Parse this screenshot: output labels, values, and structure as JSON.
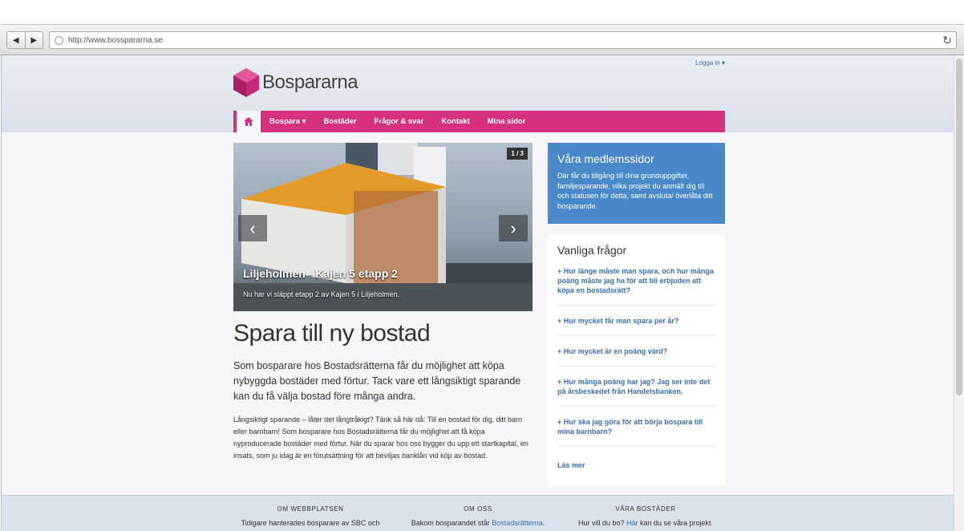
{
  "browser": {
    "url": "http://www.bosspararna.se",
    "back_icon": "back-icon",
    "forward_icon": "forward-icon",
    "reload_icon": "reload-icon"
  },
  "header": {
    "login_label": "Logga in ▾",
    "logo_text": "Bospararna"
  },
  "nav": {
    "home_icon": "home-icon",
    "items": [
      "Bospara ▾",
      "Bostäder",
      "Frågor & svar",
      "Kontakt",
      "Mina sidor"
    ]
  },
  "slider": {
    "counter": "1 / 3",
    "title": "Liljeholmen - Kajen 5 etapp 2",
    "text": "Nu har vi släppt etapp 2 av Kajen 5 i Liljeholmen."
  },
  "main": {
    "heading": "Spara till ny bostad",
    "lead": "Som bosparare hos Bostadsrätterna får du möjlighet att köpa nybyggda bostäder med förtur. Tack vare ett långsiktigt sparande kan du få välja bostad före många andra.",
    "body": "Långsiktigt sparande – låter det långtråkigt? Tänk så här då: Till en bostad för dig, ditt barn eller barnbarn! Som bosparare hos Bostadsrätterna får du möjlighet att få köpa nyproducerade bostäder med förtur. När du sparar hos oss bygger du upp ett startkapital, en insats, som ju idag är en förutsättning för att beviljas banklån vid köp av bostad."
  },
  "members_box": {
    "title": "Våra medlemssidor",
    "text": "Där får du tillgång till dina grunduppgifter, familjesparande, vilka projekt du anmält dig till och statusen för detta, samt avsluta/ överlåta ditt bosparande."
  },
  "faq": {
    "title": "Vanliga frågor",
    "items": [
      "Hur länge måste man spara, och hur många poäng måste jag ha för att bli erbjuden att köpa en bostadsrätt?",
      "Hur mycket får man spara per år?",
      "Hur mycket är en poäng värd?",
      "Hur många poäng har jag? Jag ser inte det på årsbeskedet från Handelsbanken.",
      "Hur ska jag göra för att börja bospara till mina barnbarn?"
    ],
    "more_label": "Läs mer"
  },
  "footer": {
    "col1_title": "OM WEBBPLATSEN",
    "col1_text": "Tidigare hanterades bosparare av SBC och",
    "col2_title": "OM OSS",
    "col2_text": "Bakom bosparandet står ",
    "col2_link": "Bostadsrätterna",
    "col2_after": ".",
    "col3_title": "VÅRA BOSTÄDER",
    "col3_text": "Hur vill du bo? ",
    "col3_link": "Här",
    "col3_after": " kan du se våra projekt."
  },
  "colors": {
    "brand_pink": "#d6317f",
    "link_blue": "#3a6fb0",
    "box_blue": "#4a89c9"
  }
}
